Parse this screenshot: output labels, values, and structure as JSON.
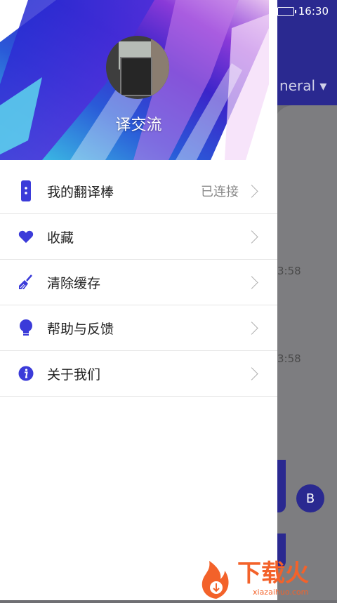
{
  "status_bar": {
    "time": "16:30"
  },
  "background": {
    "dropdown_text": "neral",
    "time_1": "3:58",
    "time_2": "3:58",
    "avatar_letter": "B"
  },
  "profile": {
    "name": "译交流"
  },
  "menu": [
    {
      "label": "我的翻译棒",
      "status": "已连接",
      "icon": "device-icon"
    },
    {
      "label": "收藏",
      "icon": "heart-icon"
    },
    {
      "label": "清除缓存",
      "icon": "broom-icon"
    },
    {
      "label": "帮助与反馈",
      "icon": "lightbulb-icon"
    },
    {
      "label": "关于我们",
      "icon": "info-icon"
    }
  ],
  "watermark": {
    "brand": "下载火",
    "url": "xiazaihuo.com"
  },
  "colors": {
    "accent": "#3b3bd9",
    "overlay": "#6f6f73",
    "topbar": "#2a2990"
  }
}
